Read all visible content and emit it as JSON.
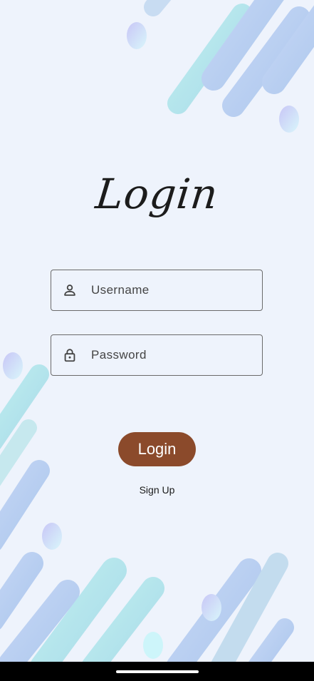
{
  "screen": {
    "title": "Login",
    "username": {
      "placeholder": "Username",
      "value": "",
      "icon": "person-icon"
    },
    "password": {
      "placeholder": "Password",
      "value": "",
      "icon": "lock-icon"
    },
    "login_button": "Login",
    "signup_link": "Sign Up"
  },
  "colors": {
    "background": "#eef3fc",
    "button": "#8b4a2b",
    "decor_blue": "#b9cdee",
    "decor_teal": "#b5e4ea"
  }
}
